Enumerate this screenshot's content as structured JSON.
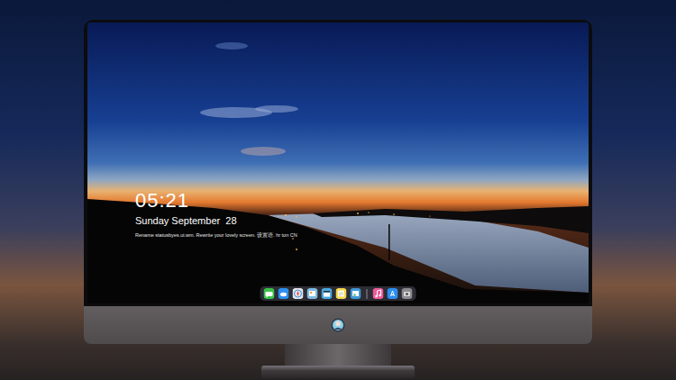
{
  "lock_screen": {
    "time": "05:21",
    "date": "Sunday September  28",
    "caption": "Rename statusbyes.ui.wm. Rewrite your lovely screen. 设置语. hr ton CN"
  },
  "dock": {
    "items": [
      {
        "kind": "app",
        "color": "#3ac34a"
      },
      {
        "kind": "app",
        "color": "#2e8ff0"
      },
      {
        "kind": "app",
        "color": "#e6e6e6"
      },
      {
        "kind": "app",
        "color": "#7fb8df"
      },
      {
        "kind": "app",
        "color": "#4aa6e0"
      },
      {
        "kind": "app",
        "color": "#f5d54a"
      },
      {
        "kind": "app",
        "color": "#3f97d6"
      },
      {
        "kind": "separator"
      },
      {
        "kind": "app",
        "color": "#f05a9a"
      },
      {
        "kind": "app",
        "color": "#2b8ef0"
      },
      {
        "kind": "app",
        "color": "#8a8a90"
      }
    ]
  }
}
